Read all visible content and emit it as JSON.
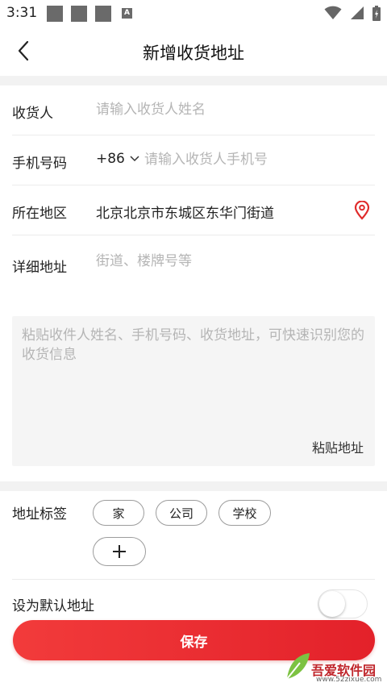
{
  "status_bar": {
    "time": "3:31",
    "badge_letter": "A",
    "icons": [
      "wifi-icon",
      "signal-icon",
      "battery-icon"
    ]
  },
  "nav": {
    "back_icon": "chevron-left-icon",
    "title": "新增收货地址"
  },
  "form": {
    "name": {
      "label": "收货人",
      "placeholder": "请输入收货人姓名",
      "value": ""
    },
    "phone": {
      "label": "手机号码",
      "country_code": "+86",
      "placeholder": "请输入收货人手机号",
      "value": ""
    },
    "region": {
      "label": "所在地区",
      "value": "北京北京市东城区东华门街道",
      "icon": "location-pin-icon"
    },
    "detail": {
      "label": "详细地址",
      "placeholder": "街道、楼牌号等",
      "value": ""
    }
  },
  "paste": {
    "placeholder": "粘贴收件人姓名、手机号码、收货地址，可快速识别您的收货信息",
    "button_label": "粘贴地址"
  },
  "tags": {
    "label": "地址标签",
    "items": [
      "家",
      "公司",
      "学校"
    ],
    "add_icon": "plus-icon"
  },
  "default_address": {
    "label": "设为默认地址",
    "enabled": false
  },
  "save": {
    "label": "保存"
  },
  "watermark": {
    "brand": "吾爱软件园",
    "url": "www.52zixue.com"
  },
  "colors": {
    "accent": "#e8282f",
    "location_icon": "#e02b2b",
    "placeholder": "#b5b5b5",
    "band": "#f2f2f2"
  }
}
